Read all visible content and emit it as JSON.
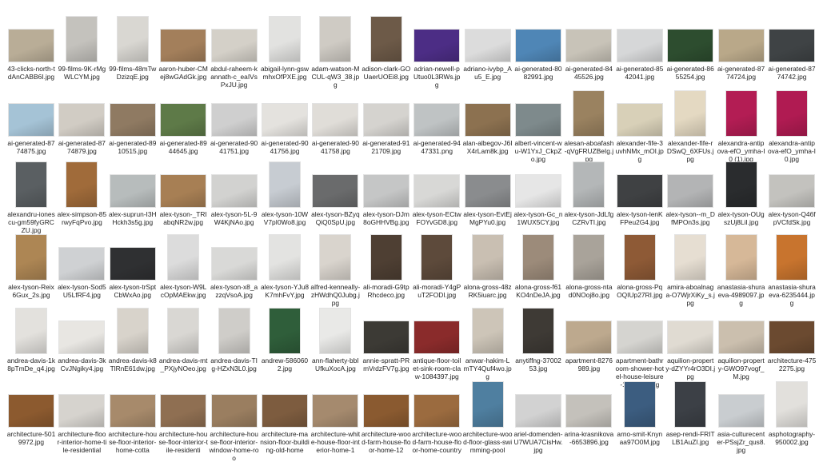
{
  "files": [
    {
      "name": "43-clicks-north-tdAnCABB6I.jpg",
      "tone": "#b9ad97",
      "thumb": "wide"
    },
    {
      "name": "99-films-9K-rMgWLCYM.jpg",
      "tone": "#c4c2bd",
      "thumb": "tall"
    },
    {
      "name": "99-films-48mTwDzizqE.jpg",
      "tone": "#d9d7d2",
      "thumb": "tall"
    },
    {
      "name": "aaron-huber-CMej8wGAdGk.jpg",
      "tone": "#a37f5b",
      "thumb": "wide"
    },
    {
      "name": "abdul-raheem-kannath-c_eaIVsPxJU.jpg",
      "tone": "#d4d0c8",
      "thumb": "wide"
    },
    {
      "name": "abigail-lynn-gswmhxOfPXE.jpg",
      "tone": "#e2e2e0",
      "thumb": "tall"
    },
    {
      "name": "adam-watson-MCUL-qW3_38.jpg",
      "tone": "#cfcbc4",
      "thumb": "tall"
    },
    {
      "name": "adison-clark-GOUaerUOEi8.jpg",
      "tone": "#6d5a48",
      "thumb": "tall"
    },
    {
      "name": "adrian-newell-pUtuo0L3RWs.jpg",
      "tone": "#4c2d85",
      "thumb": "wide"
    },
    {
      "name": "adriano-ivybp_Au5_E.jpg",
      "tone": "#dcdcdc",
      "thumb": "wide"
    },
    {
      "name": "ai-generated-8082991.jpg",
      "tone": "#4f86b6",
      "thumb": "wide"
    },
    {
      "name": "ai-generated-8445526.jpg",
      "tone": "#c8c3b8",
      "thumb": "wide"
    },
    {
      "name": "ai-generated-8542041.jpg",
      "tone": "#d6d7d8",
      "thumb": "wide"
    },
    {
      "name": "ai-generated-8655254.jpg",
      "tone": "#2d4d2f",
      "thumb": "wide"
    },
    {
      "name": "ai-generated-8774724.jpg",
      "tone": "#b9a889",
      "thumb": "wide"
    },
    {
      "name": "ai-generated-8774742.jpg",
      "tone": "#3f4345",
      "thumb": "wide"
    },
    {
      "name": "ai-generated-8774875.jpg",
      "tone": "#a5c3d6",
      "thumb": "wide"
    },
    {
      "name": "ai-generated-8774879.jpg",
      "tone": "#d1ccc4",
      "thumb": "wide"
    },
    {
      "name": "ai-generated-8910515.jpg",
      "tone": "#8f7a62",
      "thumb": "wide"
    },
    {
      "name": "ai-generated-8944645.jpg",
      "tone": "#5e7a48",
      "thumb": "wide"
    },
    {
      "name": "ai-generated-9041751.jpg",
      "tone": "#cfcfcf",
      "thumb": "wide"
    },
    {
      "name": "ai-generated-9041756.jpg",
      "tone": "#e4e2de",
      "thumb": "wide"
    },
    {
      "name": "ai-generated-9041758.jpg",
      "tone": "#e0ddd8",
      "thumb": "wide"
    },
    {
      "name": "ai-generated-9121709.jpg",
      "tone": "#d5d3cf",
      "thumb": "wide"
    },
    {
      "name": "ai-generated-9447331.png",
      "tone": "#bfc3c4",
      "thumb": "wide"
    },
    {
      "name": "alan-albegov-J6IX4rLam8k.jpg",
      "tone": "#8c7150",
      "thumb": "wide"
    },
    {
      "name": "albert-vincent-wu-W1YxJ_CkpZo.jpg",
      "tone": "#7e8a8c",
      "thumb": "wide"
    },
    {
      "name": "alesan-aboafash-qVgFRUZBeIg.jpg",
      "tone": "#9a8260",
      "thumb": "tall"
    },
    {
      "name": "alexander-fife-3uvhNMx_mOI.jpg",
      "tone": "#d8d0b8",
      "thumb": "wide"
    },
    {
      "name": "alexander-fife-rDSwQ_6XFUs.jpg",
      "tone": "#e4d9c2",
      "thumb": "tall"
    },
    {
      "name": "alexandra-antipova-efO_ymha-I0 (1).jpg",
      "tone": "#b31d54",
      "thumb": "tall"
    },
    {
      "name": "alexandra-antipova-efO_ymha-I0.jpg",
      "tone": "#b01b52",
      "thumb": "tall"
    },
    {
      "name": "alexandru-ionescu-gm59fyGRCZU.jpg",
      "tone": "#5a5f62",
      "thumb": "tall"
    },
    {
      "name": "alex-simpson-85rwyFqPvo.jpg",
      "tone": "#a06b3a",
      "thumb": "tall"
    },
    {
      "name": "alex-suprun-I3HHckh3s5g.jpg",
      "tone": "#b7bcbc",
      "thumb": "wide"
    },
    {
      "name": "alex-tyson-_TRIabqNR2w.jpg",
      "tone": "#a77f54",
      "thumb": "wide"
    },
    {
      "name": "alex-tyson-5L-9W4KjNAo.jpg",
      "tone": "#d2d2d0",
      "thumb": "wide"
    },
    {
      "name": "alex-tyson-10WV7pI0Wo8.jpg",
      "tone": "#c7ccd2",
      "thumb": "tall"
    },
    {
      "name": "alex-tyson-BZyqQiQ0SpU.jpg",
      "tone": "#6a6b6c",
      "thumb": "wide"
    },
    {
      "name": "alex-tyson-DJm8oGHHVBg.jpg",
      "tone": "#c5c6c6",
      "thumb": "wide"
    },
    {
      "name": "alex-tyson-ECtwFOYvGD8.jpg",
      "tone": "#d8d8d6",
      "thumb": "wide"
    },
    {
      "name": "alex-tyson-EvtEjMgPYu0.jpg",
      "tone": "#8a8c8e",
      "thumb": "wide"
    },
    {
      "name": "alex-tyson-Gc_n1WUX5CY.jpg",
      "tone": "#e6e6e6",
      "thumb": "wide"
    },
    {
      "name": "alex-tyson-JdLfgCZRvTI.jpg",
      "tone": "#b4b7b8",
      "thumb": "tall"
    },
    {
      "name": "alex-tyson-lenKFPeu2G4.jpg",
      "tone": "#3f4143",
      "thumb": "wide"
    },
    {
      "name": "alex-tyson--m_DfMPOn3s.jpg",
      "tone": "#b3b4b5",
      "thumb": "wide"
    },
    {
      "name": "alex-tyson-OUgszUj8LiI.jpg",
      "tone": "#2a2c2e",
      "thumb": "tall"
    },
    {
      "name": "alex-tyson-Q46fpVCfdSk.jpg",
      "tone": "#c3c2be",
      "thumb": "wide"
    },
    {
      "name": "alex-tyson-Reix6Gux_2s.jpg",
      "tone": "#ad8654",
      "thumb": "tall"
    },
    {
      "name": "alex-tyson-Sod5U5LfRF4.jpg",
      "tone": "#cfd1d3",
      "thumb": "wide"
    },
    {
      "name": "alex-tyson-trSptCbWxAo.jpg",
      "tone": "#2f3032",
      "thumb": "wide"
    },
    {
      "name": "alex-tyson-W9LcOpMAEkw.jpg",
      "tone": "#dcdcdc",
      "thumb": "tall"
    },
    {
      "name": "alex-tyson-x8_azzqVsoA.jpg",
      "tone": "#d9d9d7",
      "thumb": "wide"
    },
    {
      "name": "alex-tyson-YJu8K7mhFvY.jpg",
      "tone": "#e3e3e1",
      "thumb": "tall"
    },
    {
      "name": "alfred-kenneally-zHWdhQ0Jubg.jpg",
      "tone": "#d9d4cd",
      "thumb": "tall"
    },
    {
      "name": "ali-moradi-G9tpRhcdeco.jpg",
      "tone": "#4e3f33",
      "thumb": "tall"
    },
    {
      "name": "ali-moradi-Y4gPuT2FODI.jpg",
      "tone": "#5d4a3b",
      "thumb": "tall"
    },
    {
      "name": "alona-gross-48zRK5iuarc.jpg",
      "tone": "#c9bfb2",
      "thumb": "tall"
    },
    {
      "name": "alona-gross-f61KO4nDeJA.jpg",
      "tone": "#9c8b7a",
      "thumb": "tall"
    },
    {
      "name": "alona-gross-ntad0NOoj8o.jpg",
      "tone": "#a9a39a",
      "thumb": "tall"
    },
    {
      "name": "alona-gross-PqOQIUp27RI.jpg",
      "tone": "#8e5a36",
      "thumb": "tall"
    },
    {
      "name": "amira-aboalnaga-O7WjrXiKy_s.jpg",
      "tone": "#e6ded2",
      "thumb": "tall"
    },
    {
      "name": "anastasia-shuraeva-4989097.jpg",
      "tone": "#d6b898",
      "thumb": "tall"
    },
    {
      "name": "anastasia-shuraeva-6235444.jpg",
      "tone": "#c8742e",
      "thumb": "tall"
    },
    {
      "name": "andrea-davis-1k8pTmDe_q4.jpg",
      "tone": "#e3e1dd",
      "thumb": "tall"
    },
    {
      "name": "andrea-davis-3kCvJNgiky4.jpg",
      "tone": "#e8e6e2",
      "thumb": "wide"
    },
    {
      "name": "andrea-davis-k8TlRnE61dw.jpg",
      "tone": "#d8d3cb",
      "thumb": "tall"
    },
    {
      "name": "andrea-davis-mt_PXjyNOeo.jpg",
      "tone": "#d9d7d3",
      "thumb": "tall"
    },
    {
      "name": "andrea-davis-TIg-HZxN3L0.jpg",
      "tone": "#cfcdc9",
      "thumb": "tall"
    },
    {
      "name": "andrew-5860602.jpg",
      "tone": "#2f5e3a",
      "thumb": "tall"
    },
    {
      "name": "ann-flaherty-bbIUfkuXocA.jpg",
      "tone": "#e9e9e7",
      "thumb": "tall"
    },
    {
      "name": "annie-spratt-PRmVrdzFV7g.jpg",
      "tone": "#3c3a35",
      "thumb": "wide"
    },
    {
      "name": "antique-floor-toilet-sink-room-claw-1084397.jpg",
      "tone": "#8a2b2b",
      "thumb": "wide"
    },
    {
      "name": "anwar-hakim-LmTY4Quf4wo.jpg",
      "tone": "#cdc5b8",
      "thumb": "tall"
    },
    {
      "name": "anytiffng-3700253.jpg",
      "tone": "#3e3a35",
      "thumb": "tall"
    },
    {
      "name": "apartment-8276989.jpg",
      "tone": "#bda98e",
      "thumb": "wide"
    },
    {
      "name": "apartment-bathroom-shower-hotel-house-leisure-1654361.jpg",
      "tone": "#d5d4d0",
      "thumb": "wide"
    },
    {
      "name": "aquilion-property-dZYYr4rO3DI.jpg",
      "tone": "#e0dbd2",
      "thumb": "wide"
    },
    {
      "name": "aquilion-property-GWO97vogf_M.jpg",
      "tone": "#cbbfae",
      "thumb": "wide"
    },
    {
      "name": "architecture-4752275.jpg",
      "tone": "#6b4a30",
      "thumb": "wide"
    },
    {
      "name": "architecture-5019972.jpg",
      "tone": "#8c5a2f",
      "thumb": "wide"
    },
    {
      "name": "architecture-floor-interior-home-tile-residential",
      "tone": "#d6d3ce",
      "thumb": "wide"
    },
    {
      "name": "architecture-house-floor-interior-home-cotta",
      "tone": "#a78a6b",
      "thumb": "wide"
    },
    {
      "name": "architecture-house-floor-interior-tile-residenti",
      "tone": "#8f6f52",
      "thumb": "wide"
    },
    {
      "name": "architecture-house-floor-interior-window-home-roo",
      "tone": "#9a7e60",
      "thumb": "wide"
    },
    {
      "name": "architecture-mansion-floor-building-old-home",
      "tone": "#7d5c3f",
      "thumb": "wide"
    },
    {
      "name": "architecture-white-house-floor-interior-home-1",
      "tone": "#a58a6e",
      "thumb": "wide"
    },
    {
      "name": "architecture-wood-farm-house-floor-home-12",
      "tone": "#8a5a30",
      "thumb": "wide"
    },
    {
      "name": "architecture-wood-farm-house-floor-home-country",
      "tone": "#9b6b3f",
      "thumb": "wide"
    },
    {
      "name": "architecture-wood-floor-glass-swimming-pool",
      "tone": "#4f7fa0",
      "thumb": "tall"
    },
    {
      "name": "ariel-domenden-U7WUA7CisHw.jpg",
      "tone": "#d2d2d2",
      "thumb": "wide"
    },
    {
      "name": "arina-krasnikova-6653896.jpg",
      "tone": "#c4c1bb",
      "thumb": "wide"
    },
    {
      "name": "arno-smit-Knyn aa97O0M.jpg",
      "tone": "#3c5d80",
      "thumb": "tall"
    },
    {
      "name": "asep-rendi-FRITLB1AuZI.jpg",
      "tone": "#3c4046",
      "thumb": "tall"
    },
    {
      "name": "asia-culturecenter-PSsjZr_qus8.jpg",
      "tone": "#c9cdd0",
      "thumb": "wide"
    },
    {
      "name": "asphotography-950002.jpg",
      "tone": "#e2e0dc",
      "thumb": "tall"
    }
  ]
}
